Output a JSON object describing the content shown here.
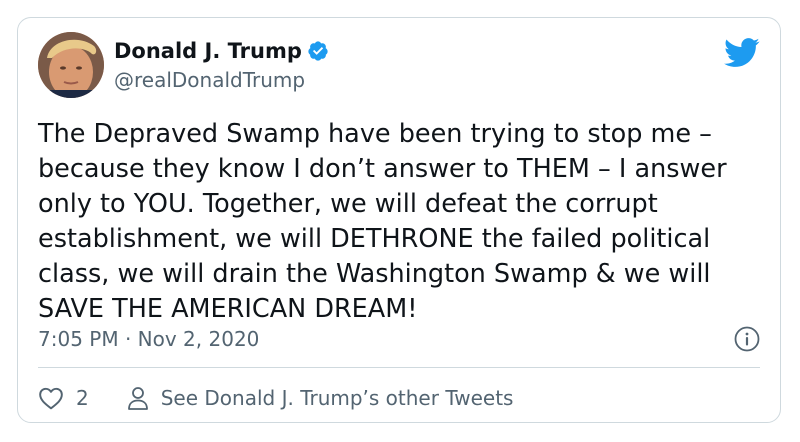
{
  "tweet": {
    "author": {
      "display_name": "Donald J. Trump",
      "handle": "@realDonaldTrump",
      "verified": true
    },
    "text": "The Depraved Swamp have been trying to stop me –\nbecause they know I don’t answer to THEM – I answer\nonly to YOU. Together, we will defeat the corrupt\nestablishment, we will DETHRONE the failed political\nclass, we will drain the Washington Swamp & we will\nSAVE THE AMERICAN DREAM!",
    "timestamp": "7:05 PM · Nov 2, 2020",
    "like_count": "2",
    "profile_link_label": "See Donald J. Trump’s other Tweets"
  },
  "icons": {
    "brand": "twitter-bird-icon",
    "verified": "verified-badge-icon",
    "info": "info-icon",
    "like": "heart-icon",
    "profile": "person-icon"
  },
  "colors": {
    "brand_blue": "#1d9bf0",
    "text_primary": "#0f1419",
    "text_secondary": "#536471",
    "border": "#cfd9de"
  }
}
